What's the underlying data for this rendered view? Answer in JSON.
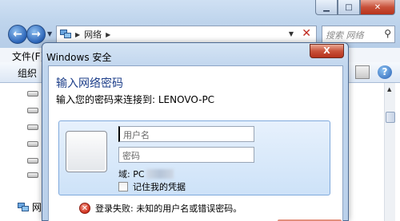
{
  "explorer": {
    "address": {
      "crumb": "网络"
    },
    "search_placeholder": "搜索 网络",
    "menubar_label": "文件(F)",
    "toolbar_label": "组织",
    "status_label": "网"
  },
  "dialog": {
    "title": "Windows 安全",
    "close_label": "X",
    "heading": "输入网络密码",
    "subheading": "输入您的密码来连接到: LENOVO-PC",
    "username_placeholder": "用户名",
    "password_placeholder": "密码",
    "domain_prefix": "域: PC",
    "remember_label": "记住我的凭据",
    "error_text": "登录失败: 未知的用户名或错误密码。"
  }
}
